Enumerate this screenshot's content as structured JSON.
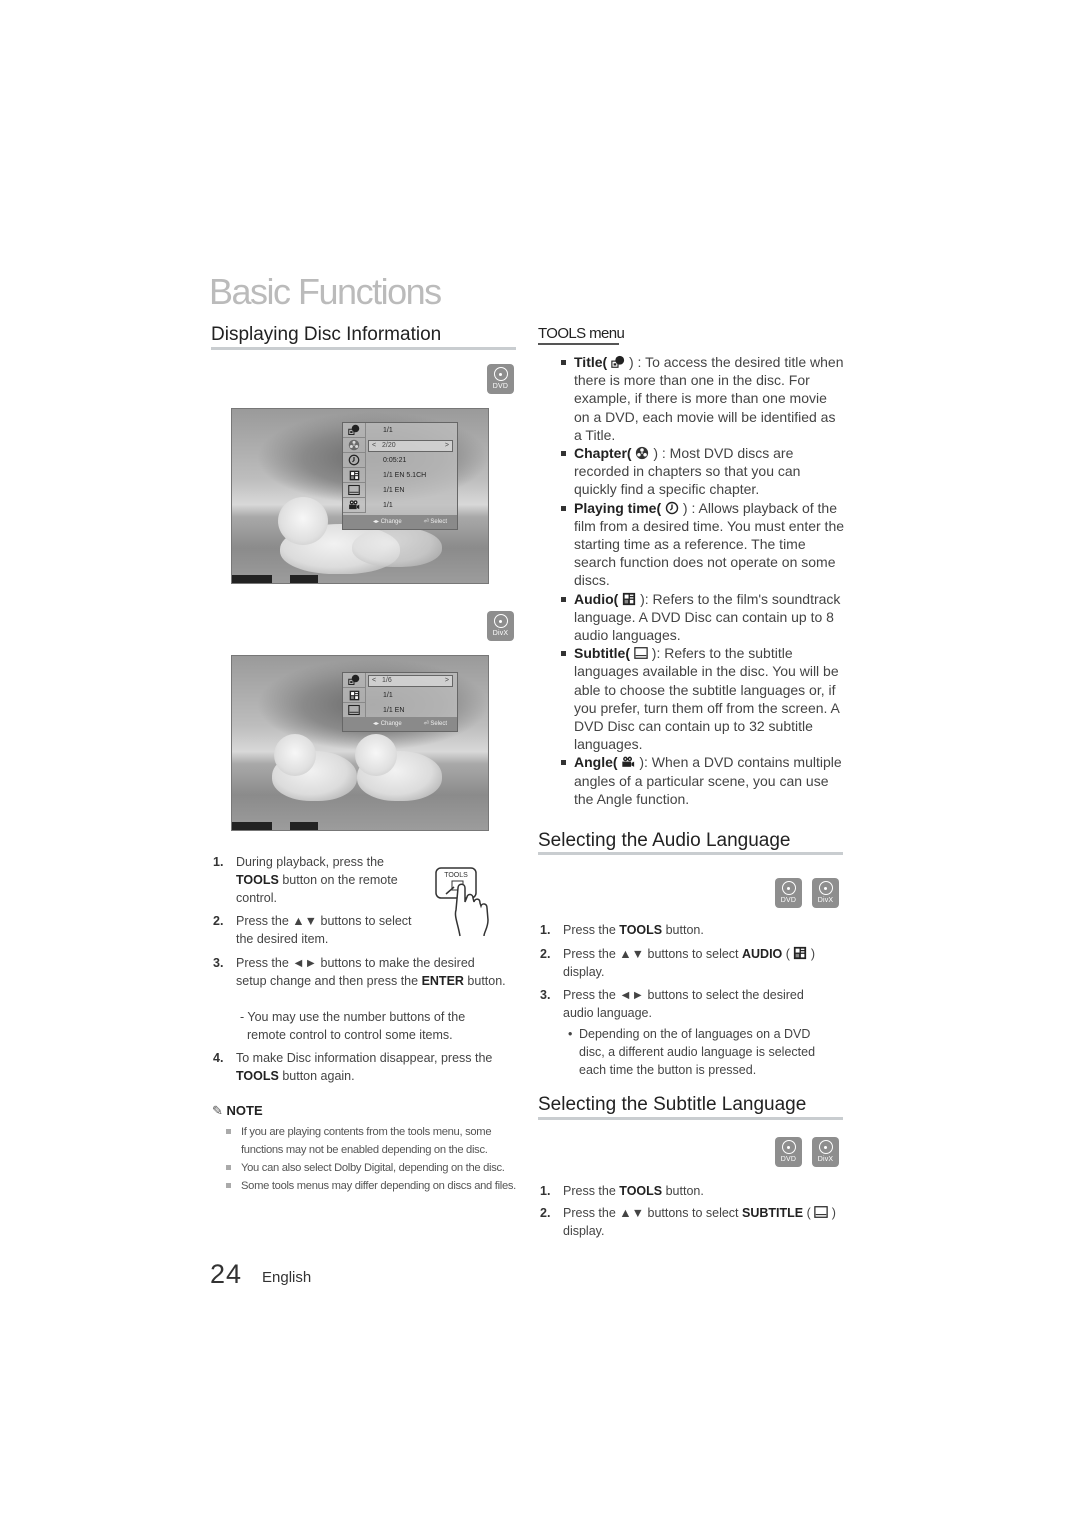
{
  "chapter_title": "Basic Functions",
  "left": {
    "section_title": "Displaying Disc Information",
    "badge_dvd": "DVD",
    "badge_divx": "DivX",
    "osd_dvd": {
      "icons": [
        "title-icon",
        "chapter-icon",
        "playing-time-icon",
        "audio-icon",
        "subtitle-icon",
        "angle-icon"
      ],
      "rows": [
        "1/1",
        "2/20",
        "0:05:21",
        "1/1 EN 5.1CH",
        "1/1 EN",
        "1/1"
      ],
      "selected_index": 1,
      "footer_change": "Change",
      "footer_select": "Select"
    },
    "osd_divx": {
      "icons": [
        "title-icon",
        "audio-icon",
        "subtitle-icon"
      ],
      "rows": [
        "1/6",
        "1/1",
        "1/1 EN"
      ],
      "selected_index": 0,
      "footer_change": "Change",
      "footer_select": "Select"
    },
    "remote_button_label": "TOOLS",
    "steps": [
      {
        "num": "1.",
        "pre": "During playback, press the",
        "bold": "TOOLS",
        "post": " button on the remote control."
      },
      {
        "num": "2.",
        "text": "Press the ▲▼ buttons to select the desired item."
      },
      {
        "num": "3.",
        "pre": "Press the ◄► buttons to make the desired setup change and then press the ",
        "bold": "ENTER",
        "post": " button.",
        "sub": "- You may use the number buttons of the remote control to control some items."
      },
      {
        "num": "4.",
        "pre": "To make Disc information disappear, press the ",
        "bold": "TOOLS",
        "post": " button again."
      }
    ],
    "note_title": "NOTE",
    "notes": [
      "If you are playing contents from the tools menu, some functions may not be enabled depending on the disc.",
      "You can also select Dolby Digital, depending on the disc.",
      "Some tools menus may differ depending on discs and files."
    ]
  },
  "right": {
    "tools_menu_title": "TOOLS menu",
    "tools_items": [
      {
        "term": "Title(",
        "icon": "title-icon",
        "desc": ") : To access the desired title when there is more than one in the disc. For example, if there is more than one movie on a DVD, each movie will be identified as a Title."
      },
      {
        "term": "Chapter(",
        "icon": "chapter-icon",
        "desc": ") : Most DVD discs are recorded in chapters so that you can quickly find a specific chapter."
      },
      {
        "term": "Playing time(",
        "icon": "playing-time-icon",
        "desc": ") : Allows playback of the film from a desired time. You must enter the starting time as a reference. The time search function does not operate on some discs."
      },
      {
        "term": "Audio(",
        "icon": "audio-icon",
        "desc": "): Refers to the film's soundtrack language. A DVD Disc can contain up to 8 audio languages."
      },
      {
        "term": "Subtitle(",
        "icon": "subtitle-icon",
        "desc": "): Refers to the subtitle languages available in the disc. You will be able to choose the subtitle languages or, if you prefer, turn them off from the screen. A DVD Disc can contain up to 32 subtitle languages."
      },
      {
        "term": "Angle(",
        "icon": "angle-icon",
        "desc": "): When a DVD contains multiple angles of a particular scene, you can use the Angle function."
      }
    ],
    "audio_section": {
      "title": "Selecting the Audio Language",
      "badges": [
        "DVD",
        "DivX"
      ],
      "steps": [
        {
          "num": "1.",
          "pre": "Press the ",
          "bold": "TOOLS",
          "post": " button."
        },
        {
          "num": "2.",
          "pre": "Press the ▲▼ buttons to select ",
          "bold": "AUDIO",
          "post": " display."
        },
        {
          "num": "3.",
          "text": "Press the ◄► buttons to select the desired audio language."
        }
      ],
      "bullet": "Depending on the of languages on a DVD disc, a different audio language is selected each time the button is pressed."
    },
    "subtitle_section": {
      "title": "Selecting the Subtitle Language",
      "badges": [
        "DVD",
        "DivX"
      ],
      "steps": [
        {
          "num": "1.",
          "pre": "Press the ",
          "bold": "TOOLS",
          "post": " button."
        },
        {
          "num": "2.",
          "pre": "Press the ▲▼ buttons to select ",
          "bold": "SUBTITLE",
          "post": " display."
        }
      ]
    }
  },
  "footer": {
    "page_number": "24",
    "language": "English"
  }
}
